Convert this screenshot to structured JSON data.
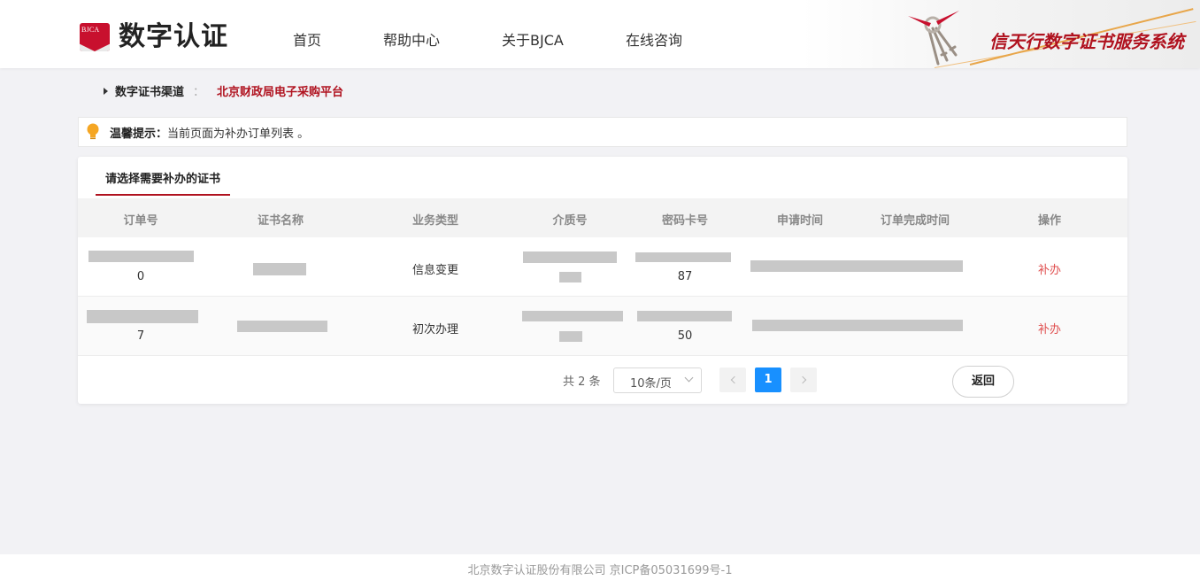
{
  "header": {
    "logo_badge_text": "BJCA",
    "logo_text": "数字认证",
    "nav": [
      {
        "label": "首页"
      },
      {
        "label": "帮助中心"
      },
      {
        "label": "关于BJCA"
      },
      {
        "label": "在线咨询"
      }
    ],
    "banner_text": "信天行数字证书服务系统"
  },
  "breadcrumb": {
    "label": "数字证书渠道",
    "separator": "：",
    "current": "北京财政局电子采购平台"
  },
  "tip": {
    "title": "温馨提示：",
    "text": "当前页面为补办订单列表 。"
  },
  "card": {
    "tab_label": "请选择需要补办的证书",
    "columns": [
      "订单号",
      "证书名称",
      "业务类型",
      "介质号",
      "密码卡号",
      "申请时间",
      "订单完成时间",
      "操作"
    ],
    "rows": [
      {
        "order_suffix": "0",
        "business_type": "信息变更",
        "card_suffix": "87",
        "action": "补办"
      },
      {
        "order_suffix": "7",
        "business_type": "初次办理",
        "card_suffix": "50",
        "action": "补办"
      }
    ]
  },
  "pagination": {
    "total": "共 2 条",
    "page_size": "10条/页",
    "current_page": "1"
  },
  "back_button": "返回",
  "footer": {
    "text": "北京数字认证股份有限公司 京ICP备05031699号-1"
  },
  "colors": {
    "brand_red": "#b0121f",
    "action_red": "#e05050",
    "active_page_blue": "#1890ff"
  }
}
